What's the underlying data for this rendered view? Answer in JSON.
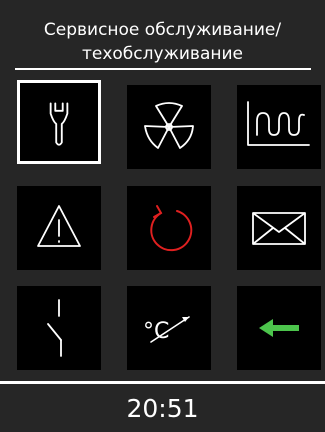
{
  "header": {
    "title_line1": "Сервисное обслуживание/",
    "title_line2": "техобслуживание"
  },
  "menu": {
    "items": [
      {
        "icon": "wrench-icon",
        "selected": true
      },
      {
        "icon": "fan-icon",
        "selected": false
      },
      {
        "icon": "heating-coil-icon",
        "selected": false
      },
      {
        "icon": "warning-icon",
        "selected": false
      },
      {
        "icon": "refresh-circle-icon",
        "selected": false
      },
      {
        "icon": "envelope-icon",
        "selected": false
      },
      {
        "icon": "switch-icon",
        "selected": false
      },
      {
        "icon": "temperature-adjust-icon",
        "selected": false
      },
      {
        "icon": "back-arrow-icon",
        "selected": false
      }
    ],
    "temperature_unit_label": "°C"
  },
  "footer": {
    "time": "20:51"
  },
  "colors": {
    "background": "#262626",
    "tile": "#000000",
    "foreground": "#ffffff",
    "accent_red": "#e02020",
    "accent_green": "#4cc44c"
  }
}
